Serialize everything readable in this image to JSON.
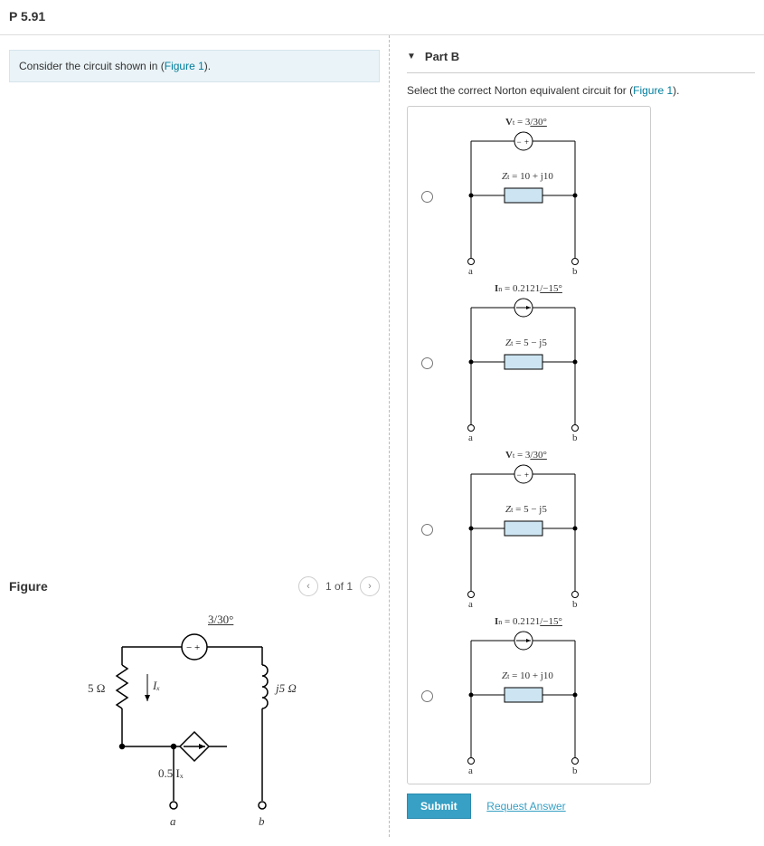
{
  "problem_number": "P 5.91",
  "prompt_prefix": "Consider the circuit shown in (",
  "prompt_link": "Figure 1",
  "prompt_suffix": ").",
  "figure": {
    "title": "Figure",
    "pager": "1 of 1",
    "source_label": "3/30°",
    "r_label": "5 Ω",
    "ix_label": "Iₓ",
    "l_label": "j5 Ω",
    "dep_label": "0.5 Iₓ",
    "term_a": "a",
    "term_b": "b"
  },
  "part": {
    "title": "Part B",
    "instruction_prefix": "Select the correct Norton equivalent circuit for (",
    "instruction_link": "Figure 1",
    "instruction_suffix": ").",
    "submit": "Submit",
    "request_answer": "Request Answer"
  },
  "options": [
    {
      "src_sym": "V",
      "src_sub": "t",
      "src_eq": "= 3",
      "src_ang": "/30°",
      "z_sym": "Z",
      "z_sub": "t",
      "z_eq": "= 10 + j10"
    },
    {
      "src_sym": "I",
      "src_sub": "n",
      "src_eq": "= 0.2121",
      "src_ang": "/−15°",
      "z_sym": "Z",
      "z_sub": "t",
      "z_eq": "= 5 − j5"
    },
    {
      "src_sym": "V",
      "src_sub": "t",
      "src_eq": "= 3",
      "src_ang": "/30°",
      "z_sym": "Z",
      "z_sub": "t",
      "z_eq": "= 5 − j5"
    },
    {
      "src_sym": "I",
      "src_sub": "n",
      "src_eq": "= 0.2121",
      "src_ang": "/−15°",
      "z_sym": "Z",
      "z_sub": "t",
      "z_eq": "= 10 + j10"
    }
  ],
  "terminals": {
    "a": "a",
    "b": "b"
  }
}
